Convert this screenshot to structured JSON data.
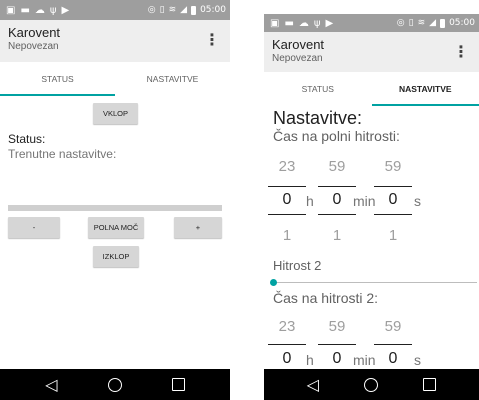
{
  "status_bar": {
    "left_icons": [
      "image-icon",
      "message-icon",
      "cloud-icon",
      "usb-icon",
      "play-icon"
    ],
    "right_icons": [
      "nfc-icon",
      "vibrate-icon",
      "wifi-icon",
      "signal-icon",
      "battery-icon"
    ],
    "time": "05:00"
  },
  "app": {
    "title": "Karovent",
    "subtitle": "Nepovezan"
  },
  "tabs": {
    "status": "STATUS",
    "settings": "NASTAVITVE"
  },
  "status_screen": {
    "on_button": "VKLOP",
    "status_label": "Status:",
    "current_settings_label": "Trenutne nastavitve:",
    "minus_button": "-",
    "full_power_button": "POLNA MOČ",
    "plus_button": "+",
    "off_button": "IZKLOP"
  },
  "settings_screen": {
    "heading": "Nastavitve:",
    "full_speed_time_label": "Čas na polni hitrosti:",
    "picker1": {
      "hours_above": "23",
      "minutes_above": "59",
      "seconds_above": "59",
      "hours": "0",
      "minutes": "0",
      "seconds": "0",
      "hours_below": "1",
      "minutes_below": "1",
      "seconds_below": "1"
    },
    "units": {
      "h": "h",
      "min": "min",
      "s": "s"
    },
    "speed2_label": "Hitrost 2",
    "speed2_level": 0,
    "speed2_time_label": "Čas na hitrosti 2:",
    "picker2": {
      "hours_above": "23",
      "minutes_above": "59",
      "seconds_above": "59",
      "hours": "0",
      "minutes": "0",
      "seconds": "0"
    }
  },
  "colors": {
    "accent": "#00a2a2",
    "status_bar": "#9e9e9e",
    "app_bar": "#eeeeee",
    "nav_bar": "#000000"
  }
}
